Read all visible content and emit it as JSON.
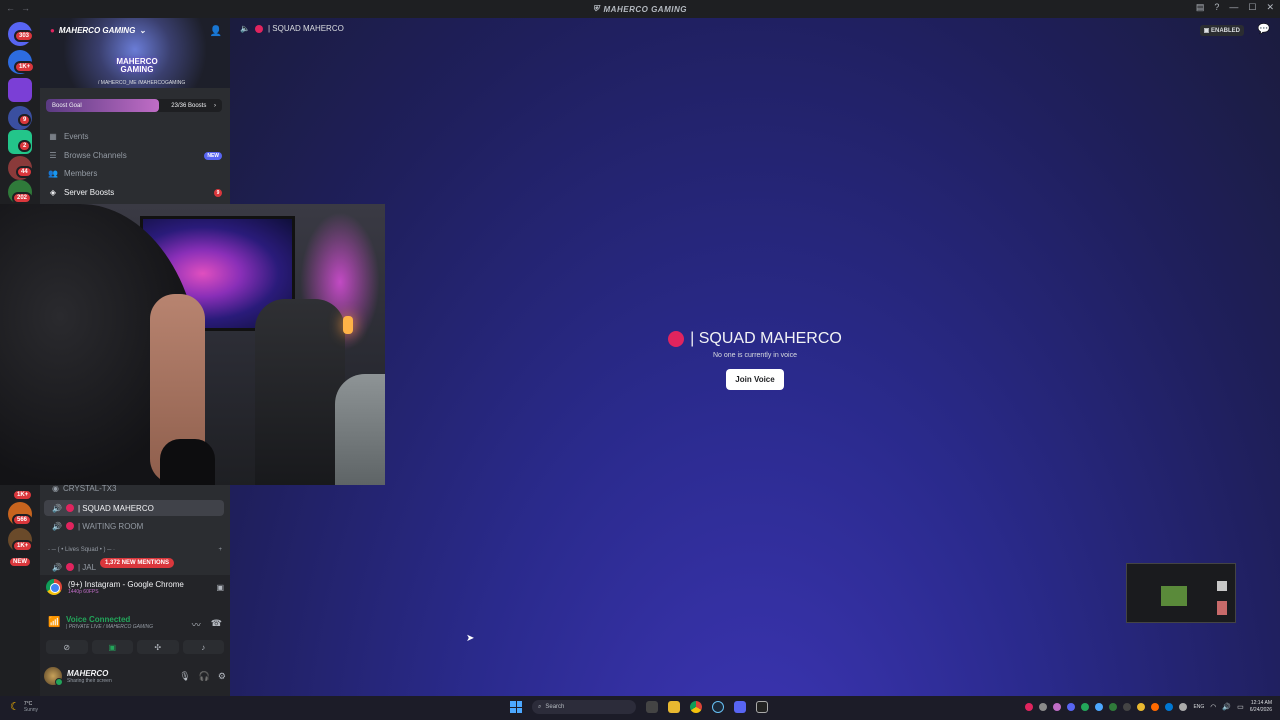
{
  "window": {
    "title": "MAHERCO GAMING"
  },
  "rail": {
    "badges": [
      "303",
      "1K+",
      "9",
      "2",
      "44",
      "202",
      "1K+",
      "566",
      "1K+"
    ],
    "new_label": "NEW"
  },
  "server": {
    "name": "MAHERCO GAMING",
    "logo_line1": "MAHERCO",
    "logo_line2": "GAMING",
    "handles": "/ MAHERCO_ME  /MAHERCOGAMING",
    "boost_goal_label": "Boost Goal",
    "boost_count": "23/36 Boosts",
    "boost_progress": 0.64
  },
  "nav": {
    "events": "Events",
    "browse": "Browse Channels",
    "browse_badge": "NEW",
    "members": "Members",
    "server_boosts": "Server Boosts",
    "server_boosts_badge": "9"
  },
  "channels": {
    "partial_top": "CRYSTAL-TX3",
    "squad": "| SQUAD MAHERCO",
    "waiting": "| WAITING ROOM",
    "category": "- ─ ( • Lives Squad • ) ─ ·",
    "partial_bottom": "| JAL",
    "mentions": "1,372 NEW MENTIONS"
  },
  "panel": {
    "stream_title": "(9+) Instagram - Google Chrome",
    "stream_quality": "1440p 60FPS",
    "voice_status": "Voice Connected",
    "voice_channel": "| PRIVATE LIVE / MAHERCO GAMING",
    "username": "MAHERCO",
    "user_status": "Sharing their screen"
  },
  "main": {
    "header_channel": "| SQUAD MAHERCO",
    "enabled_label": "ENABLED",
    "title": "| SQUAD MAHERCO",
    "subtitle": "No one is currently in voice",
    "join_button": "Join Voice"
  },
  "taskbar": {
    "temperature": "7°C",
    "weather": "Sunny",
    "search": "Search",
    "language": "ENG",
    "time": "12:14 AM",
    "date": "6/24/2026"
  },
  "colors": {
    "accent": "#5865f2",
    "danger": "#da373c",
    "online": "#23a55a",
    "channel_dot": "#e0245e"
  }
}
